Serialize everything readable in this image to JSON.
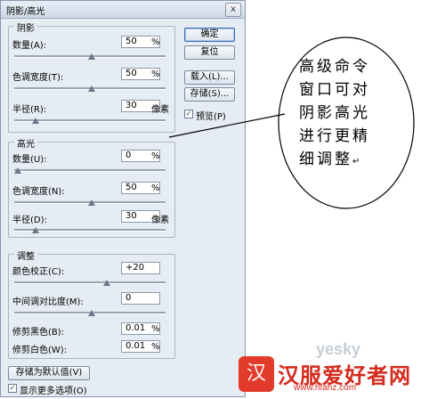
{
  "dialog": {
    "title": "阴影/高光",
    "close_glyph": "x",
    "shadows": {
      "title": "阴影",
      "amount": {
        "label": "数量(A):",
        "value": "50",
        "unit": "%",
        "level": 0.5
      },
      "tonal_width": {
        "label": "色调宽度(T):",
        "value": "50",
        "unit": "%",
        "level": 0.5
      },
      "radius": {
        "label": "半径(R):",
        "value": "30",
        "unit": "像素",
        "level": 0.12
      }
    },
    "highlights": {
      "title": "高光",
      "amount": {
        "label": "数量(U):",
        "value": "0",
        "unit": "%",
        "level": 0.0
      },
      "tonal_width": {
        "label": "色调宽度(N):",
        "value": "50",
        "unit": "%",
        "level": 0.5
      },
      "radius": {
        "label": "半径(D):",
        "value": "30",
        "unit": "像素",
        "level": 0.12
      }
    },
    "adjustments": {
      "title": "调整",
      "color_correction": {
        "label": "颜色校正(C):",
        "value": "+20",
        "level": 0.6
      },
      "midtone_contrast": {
        "label": "中间调对比度(M):",
        "value": "0",
        "level": 0.5
      },
      "black_clip": {
        "label": "修剪黑色(B):",
        "value": "0.01",
        "unit": "%"
      },
      "white_clip": {
        "label": "修剪白色(W):",
        "value": "0.01",
        "unit": "%"
      }
    },
    "buttons": {
      "ok": "确定",
      "reset": "复位",
      "load": "载入(L)...",
      "save": "存储(S)..."
    },
    "preview_label": "预览(P)",
    "preview_checked": true,
    "save_defaults_label": "存储为默认值(V)",
    "show_more_label": "显示更多选项(O)",
    "show_more_checked": true
  },
  "annotation": {
    "line1": "高级命令",
    "line2": "窗口可对",
    "line3": "阴影高光",
    "line4": "进行更精",
    "line5": "细调整",
    "mark": "↵"
  },
  "watermark": {
    "seal": "汉",
    "site_name": "汉服爱好者网",
    "url": "www.hfahz.com",
    "yesky": "yesky"
  },
  "colors": {
    "dialog_bg": "#e6ecf3",
    "watermark_red": "#d52a1e"
  }
}
